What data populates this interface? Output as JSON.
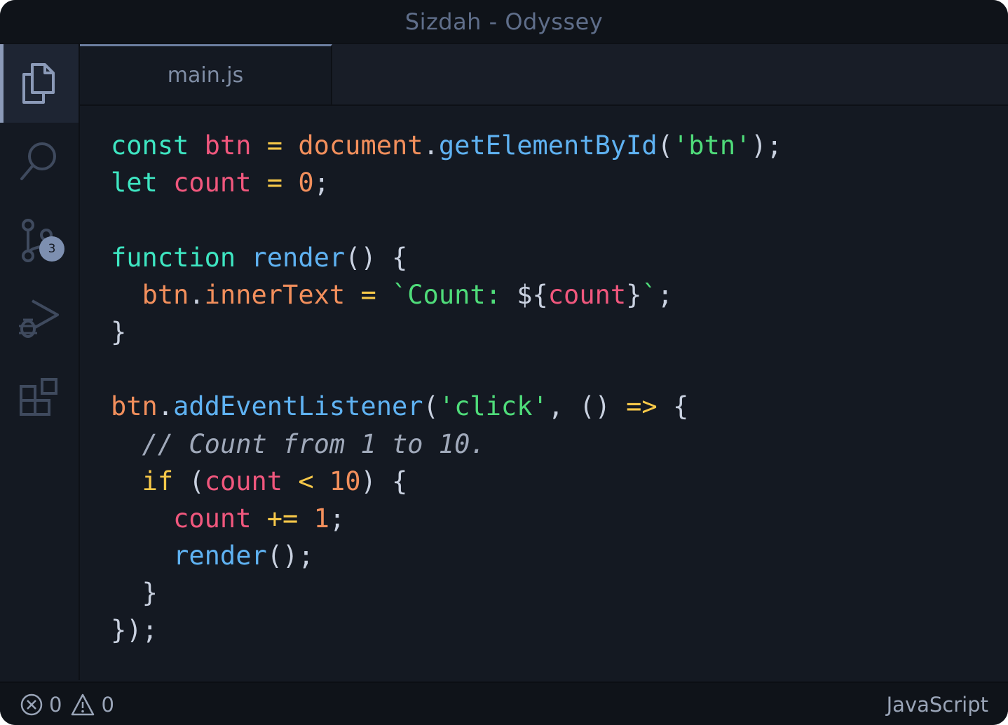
{
  "window": {
    "title": "Sizdah - Odyssey"
  },
  "activity_bar": {
    "items": [
      {
        "icon": "files-icon",
        "active": true
      },
      {
        "icon": "search-icon",
        "active": false
      },
      {
        "icon": "source-control-icon",
        "active": false,
        "badge": "3"
      },
      {
        "icon": "run-debug-icon",
        "active": false
      },
      {
        "icon": "extensions-icon",
        "active": false
      }
    ]
  },
  "tabs": [
    {
      "label": "main.js",
      "active": true
    }
  ],
  "editor": {
    "language": "javascript",
    "lines": [
      "const btn = document.getElementById('btn');",
      "let count = 0;",
      "",
      "function render() {",
      "  btn.innerText = `Count: ${count}`;",
      "}",
      "",
      "btn.addEventListener('click', () => {",
      "  // Count from 1 to 10.",
      "  if (count < 10) {",
      "    count += 1;",
      "    render();",
      "  }",
      "});"
    ]
  },
  "status_bar": {
    "errors": "0",
    "warnings": "0",
    "language": "JavaScript"
  },
  "colors": {
    "background": "#141922",
    "keyword": "#3ee6c2",
    "variable": "#f0577d",
    "operator": "#f7c849",
    "object": "#f28f5c",
    "function": "#5fb2f2",
    "string": "#4fdc7a",
    "comment": "#a0a9ba"
  }
}
